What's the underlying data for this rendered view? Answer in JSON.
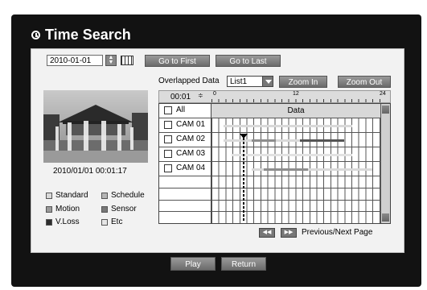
{
  "window": {
    "title": "Time Search"
  },
  "date": {
    "value": "2010-01-01"
  },
  "buttons": {
    "go_first": "Go to First",
    "go_last": "Go to Last",
    "zoom_in": "Zoom In",
    "zoom_out": "Zoom Out",
    "play": "Play",
    "return": "Return"
  },
  "overlap": {
    "label": "Overlapped Data",
    "selected": "List1"
  },
  "preview": {
    "timestamp": "2010/01/01  00:01:17"
  },
  "timeline": {
    "time": "00:01",
    "ticks": [
      "0",
      "12",
      "24"
    ],
    "data_header": "Data",
    "rows": [
      {
        "label": "All"
      },
      {
        "label": "CAM 01"
      },
      {
        "label": "CAM 02"
      },
      {
        "label": "CAM 03"
      },
      {
        "label": "CAM 04"
      }
    ]
  },
  "legend": {
    "standard": "Standard",
    "schedule": "Schedule",
    "motion": "Motion",
    "sensor": "Sensor",
    "vloss": "V.Loss",
    "etc": "Etc"
  },
  "colors": {
    "standard": "#d9d9d9",
    "schedule": "#b5b5b5",
    "motion": "#9a9a9a",
    "sensor": "#777777",
    "vloss": "#2d2d2d",
    "etc": "#e6e6e6"
  },
  "paging": {
    "label": "Previous/Next Page"
  }
}
